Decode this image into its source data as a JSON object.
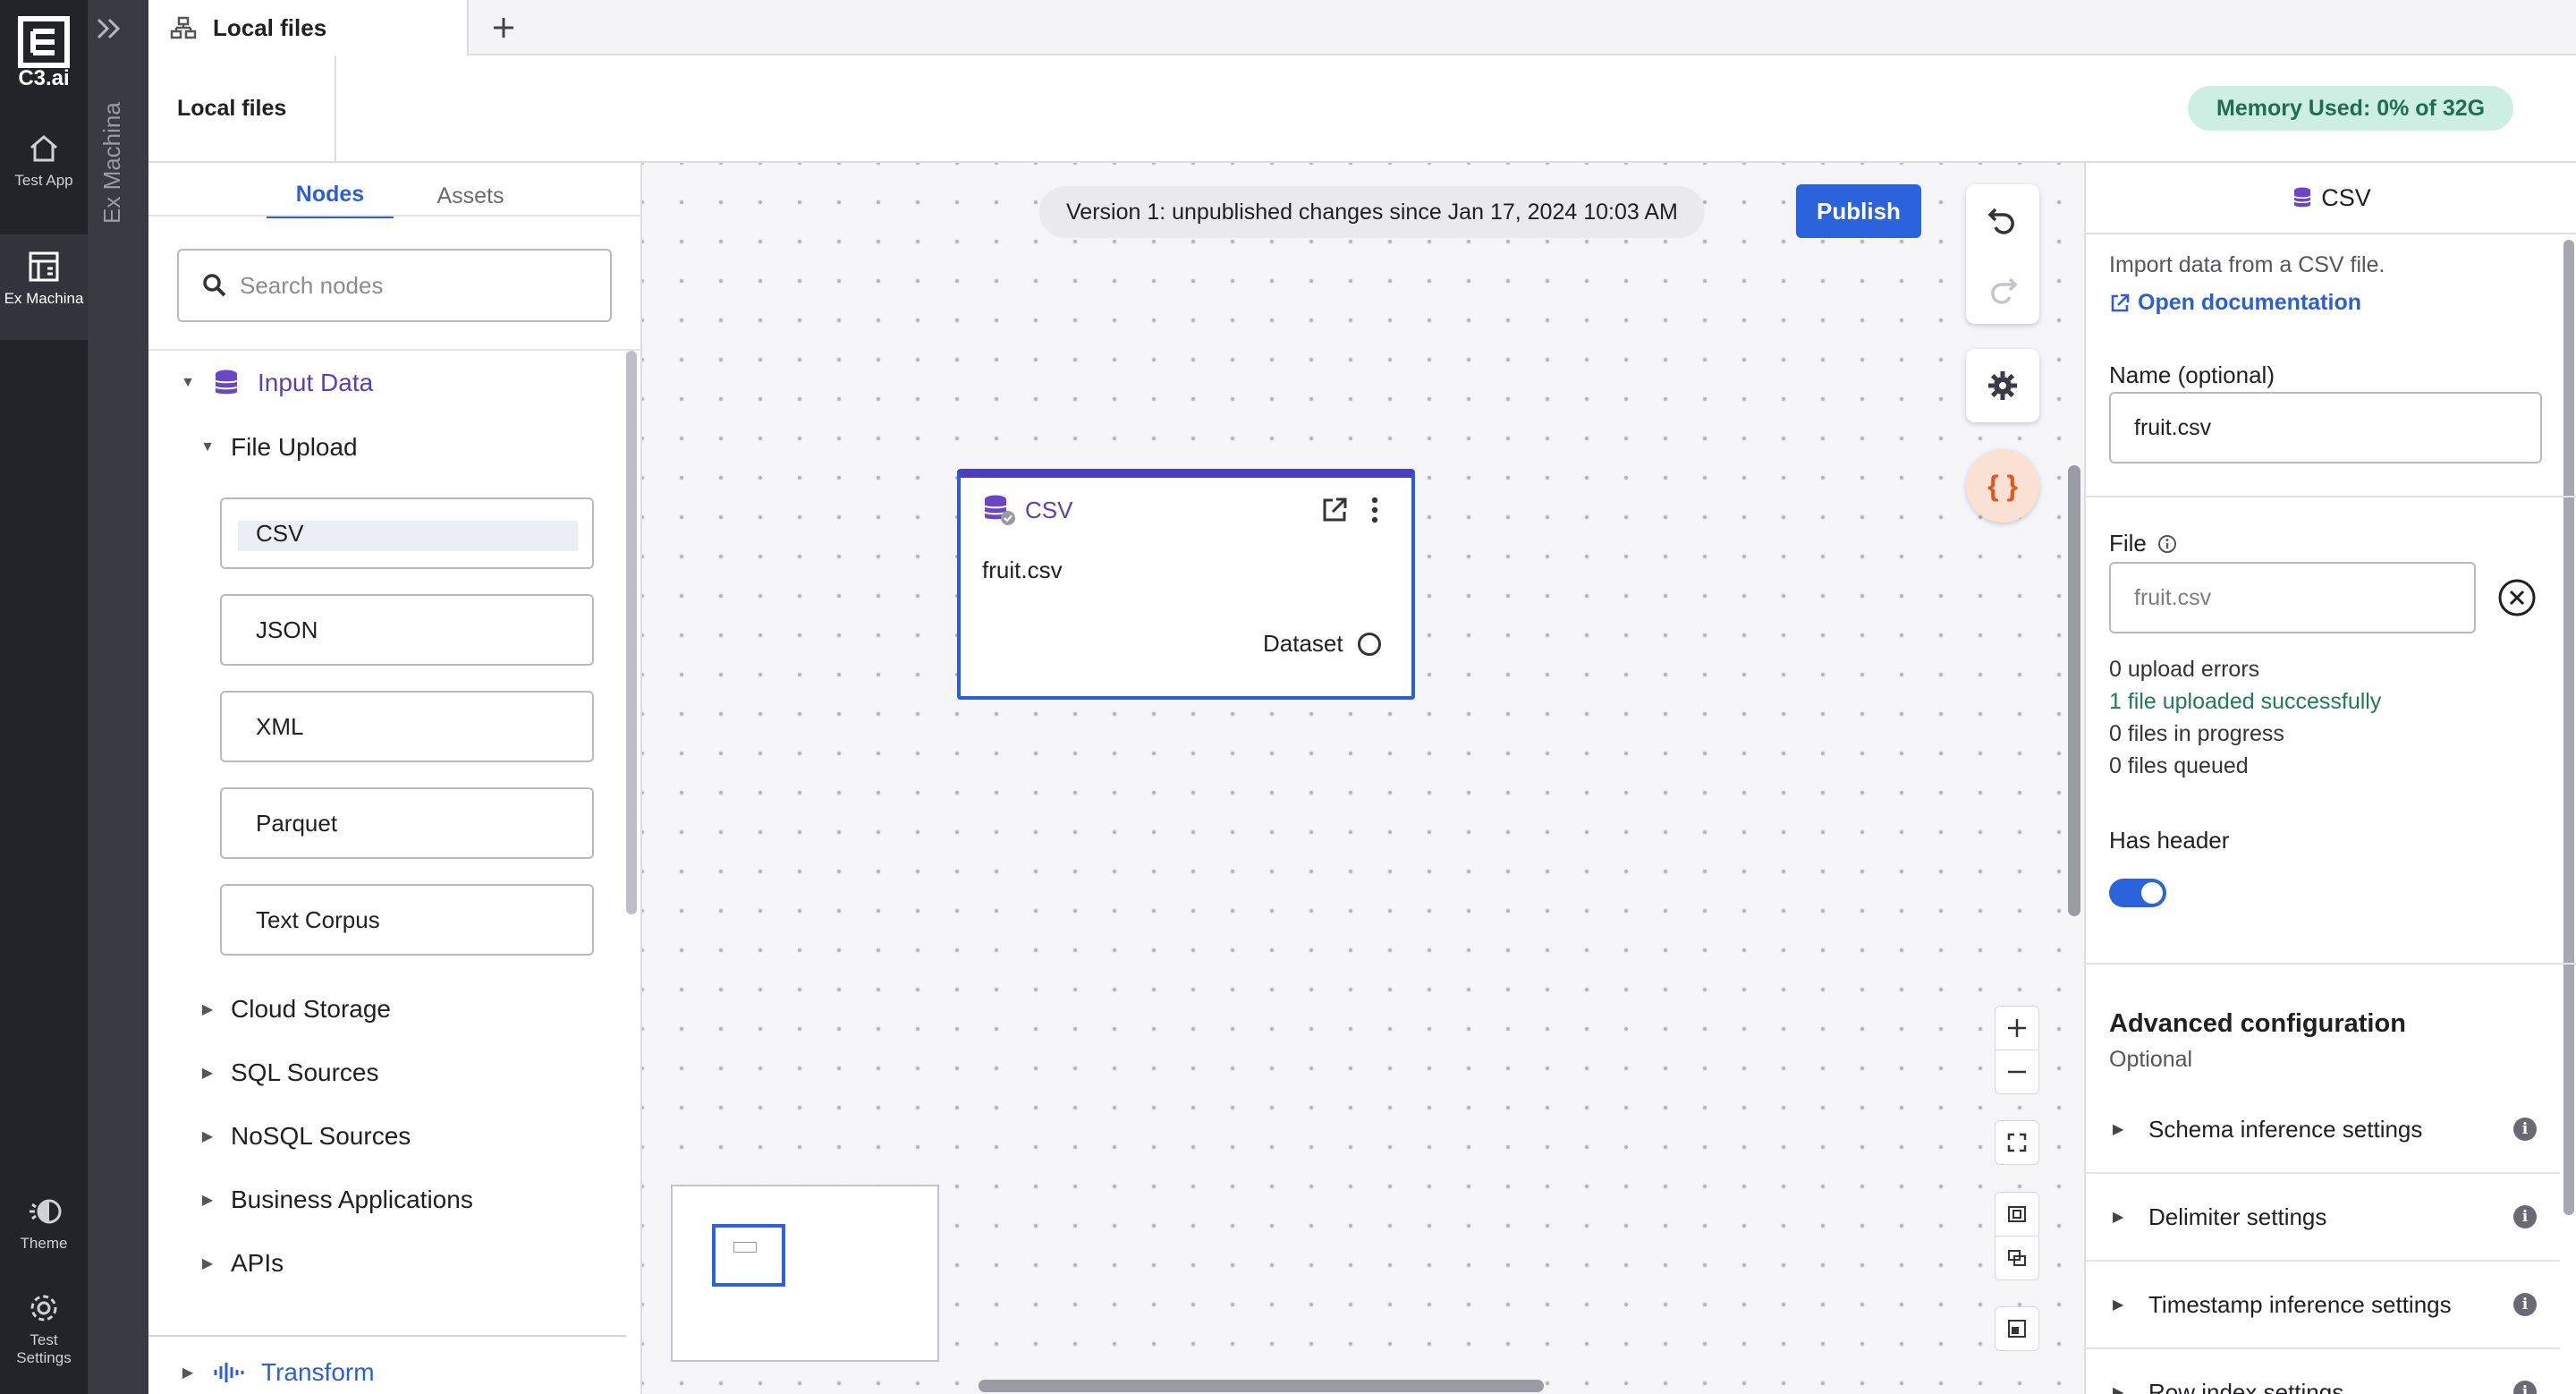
{
  "rail": {
    "brand": "C3.ai",
    "items": [
      {
        "label": "Test App",
        "icon": "home-icon"
      },
      {
        "label": "Ex Machina",
        "icon": "ex-machina-icon"
      }
    ],
    "bottom": [
      {
        "label": "Theme",
        "icon": "theme-icon"
      },
      {
        "label": "Test Settings",
        "icon": "gear-icon"
      }
    ]
  },
  "strip": {
    "label": "Ex Machina"
  },
  "tabs": {
    "active_label": "Local files"
  },
  "header": {
    "title": "Local files",
    "memory": "Memory Used: 0% of 32G"
  },
  "palette": {
    "tabs": [
      "Nodes",
      "Assets"
    ],
    "search_placeholder": "Search nodes",
    "groups": {
      "input_data": "Input Data",
      "file_upload": "File Upload",
      "file_nodes": [
        "CSV",
        "JSON",
        "XML",
        "Parquet",
        "Text Corpus"
      ],
      "collapsed": [
        "Cloud Storage",
        "SQL Sources",
        "NoSQL Sources",
        "Business Applications",
        "APIs"
      ],
      "transform": "Transform"
    }
  },
  "canvas": {
    "version": "Version 1: unpublished changes since Jan 17, 2024 10:03 AM",
    "publish": "Publish",
    "code_button": "{ }",
    "node": {
      "type": "CSV",
      "file": "fruit.csv",
      "port_label": "Dataset"
    }
  },
  "config": {
    "title": "CSV",
    "description": "Import data from a CSV file.",
    "doc_link": "Open documentation",
    "name_label": "Name (optional)",
    "name_value": "fruit.csv",
    "file_label": "File",
    "file_value": "fruit.csv",
    "upload_errors": "0 upload errors",
    "uploaded": "1 file uploaded successfully",
    "in_progress": "0 files in progress",
    "queued": "0 files queued",
    "has_header_label": "Has header",
    "has_header": true,
    "advanced_title": "Advanced configuration",
    "advanced_sub": "Optional",
    "advanced_items": [
      "Schema inference settings",
      "Delimiter settings",
      "Timestamp inference settings",
      "Row index settings"
    ]
  },
  "colors": {
    "accent": "#2b63dd",
    "purple": "#5a3fb8",
    "success": "#1f7a55",
    "memory_bg": "#cdeee3"
  }
}
